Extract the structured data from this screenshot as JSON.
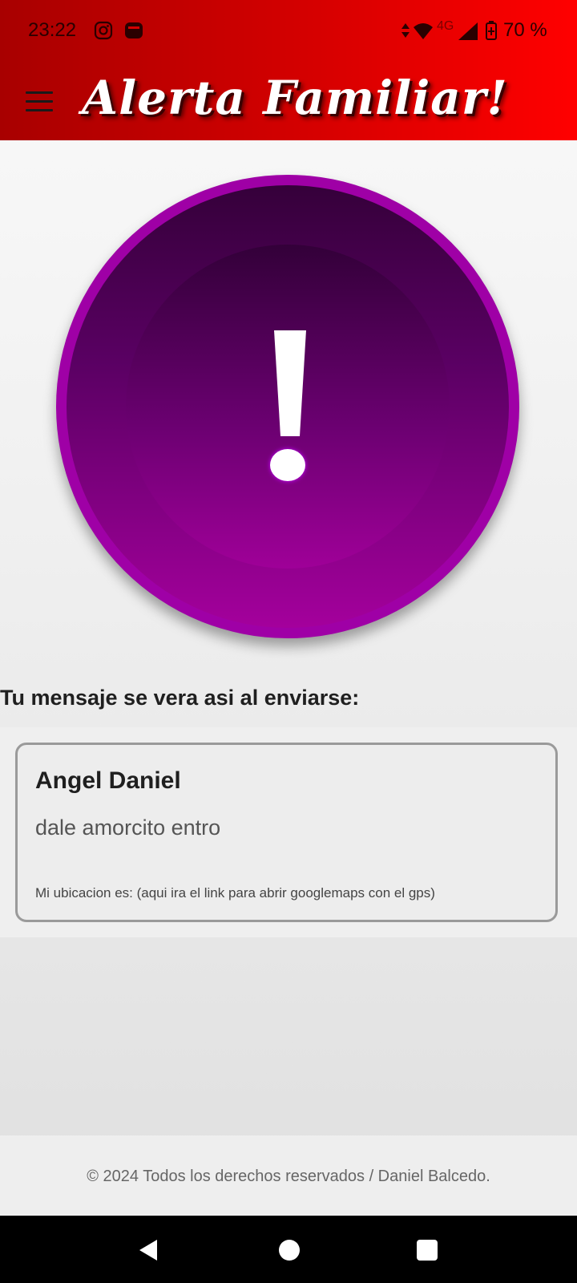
{
  "status_bar": {
    "time": "23:22",
    "network_type": "4G",
    "battery": "70 %",
    "icons": [
      "instagram-icon",
      "ad-app-icon",
      "data-activity-icon",
      "wifi-icon",
      "signal-icon",
      "battery-icon"
    ]
  },
  "header": {
    "title": "Alerta Familiar!",
    "menu_icon": "hamburger-menu-icon"
  },
  "alert_button": {
    "icon": "exclamation-icon",
    "color": "#9f00a6"
  },
  "preview": {
    "heading": "Tu mensaje se vera asi al enviarse:",
    "sender": "Angel Daniel",
    "message": "dale amorcito entro",
    "location": "Mi ubicacion es: (aqui ira el link para abrir googlemaps con el gps)"
  },
  "footer": {
    "text": "© 2024 Todos los derechos reservados / Daniel Balcedo."
  },
  "nav_bar": {
    "icons": [
      "back-icon",
      "home-icon",
      "recents-icon"
    ]
  },
  "colors": {
    "header_start": "#a80000",
    "header_end": "#ff0000",
    "alert_purple": "#9f00a6"
  }
}
